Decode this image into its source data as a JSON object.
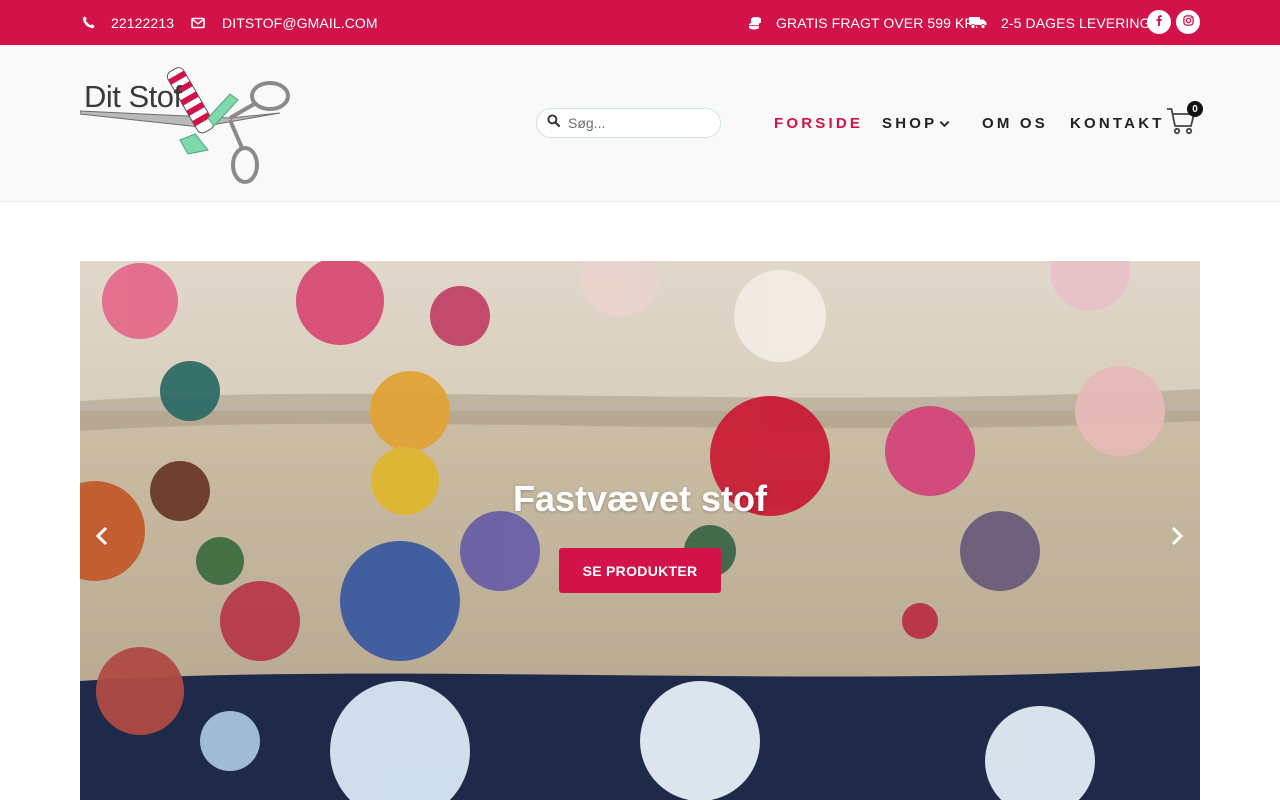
{
  "topbar": {
    "phone": "22122213",
    "email": "DITSTOF@GMAIL.COM",
    "shipping": "GRATIS FRAGT OVER 599 KR.",
    "delivery": "2-5 DAGES LEVERING",
    "icons": [
      "phone-icon",
      "envelope-icon",
      "coins-icon",
      "truck-icon",
      "facebook-icon",
      "instagram-icon"
    ],
    "background": "#d3124a"
  },
  "header": {
    "logo_text": "Dit Stof",
    "search": {
      "placeholder": "Søg..."
    },
    "nav": [
      {
        "label": "FORSIDE",
        "active": true
      },
      {
        "label": "SHOP",
        "has_dropdown": true
      },
      {
        "label": "OM OS"
      },
      {
        "label": "KONTAKT"
      }
    ],
    "cart_count": "0",
    "accent": "#d3124a"
  },
  "hero": {
    "title": "Fastvævet stof",
    "button_label": "SE PRODUKTER",
    "icons": [
      "chevron-left-icon",
      "chevron-right-icon"
    ]
  }
}
